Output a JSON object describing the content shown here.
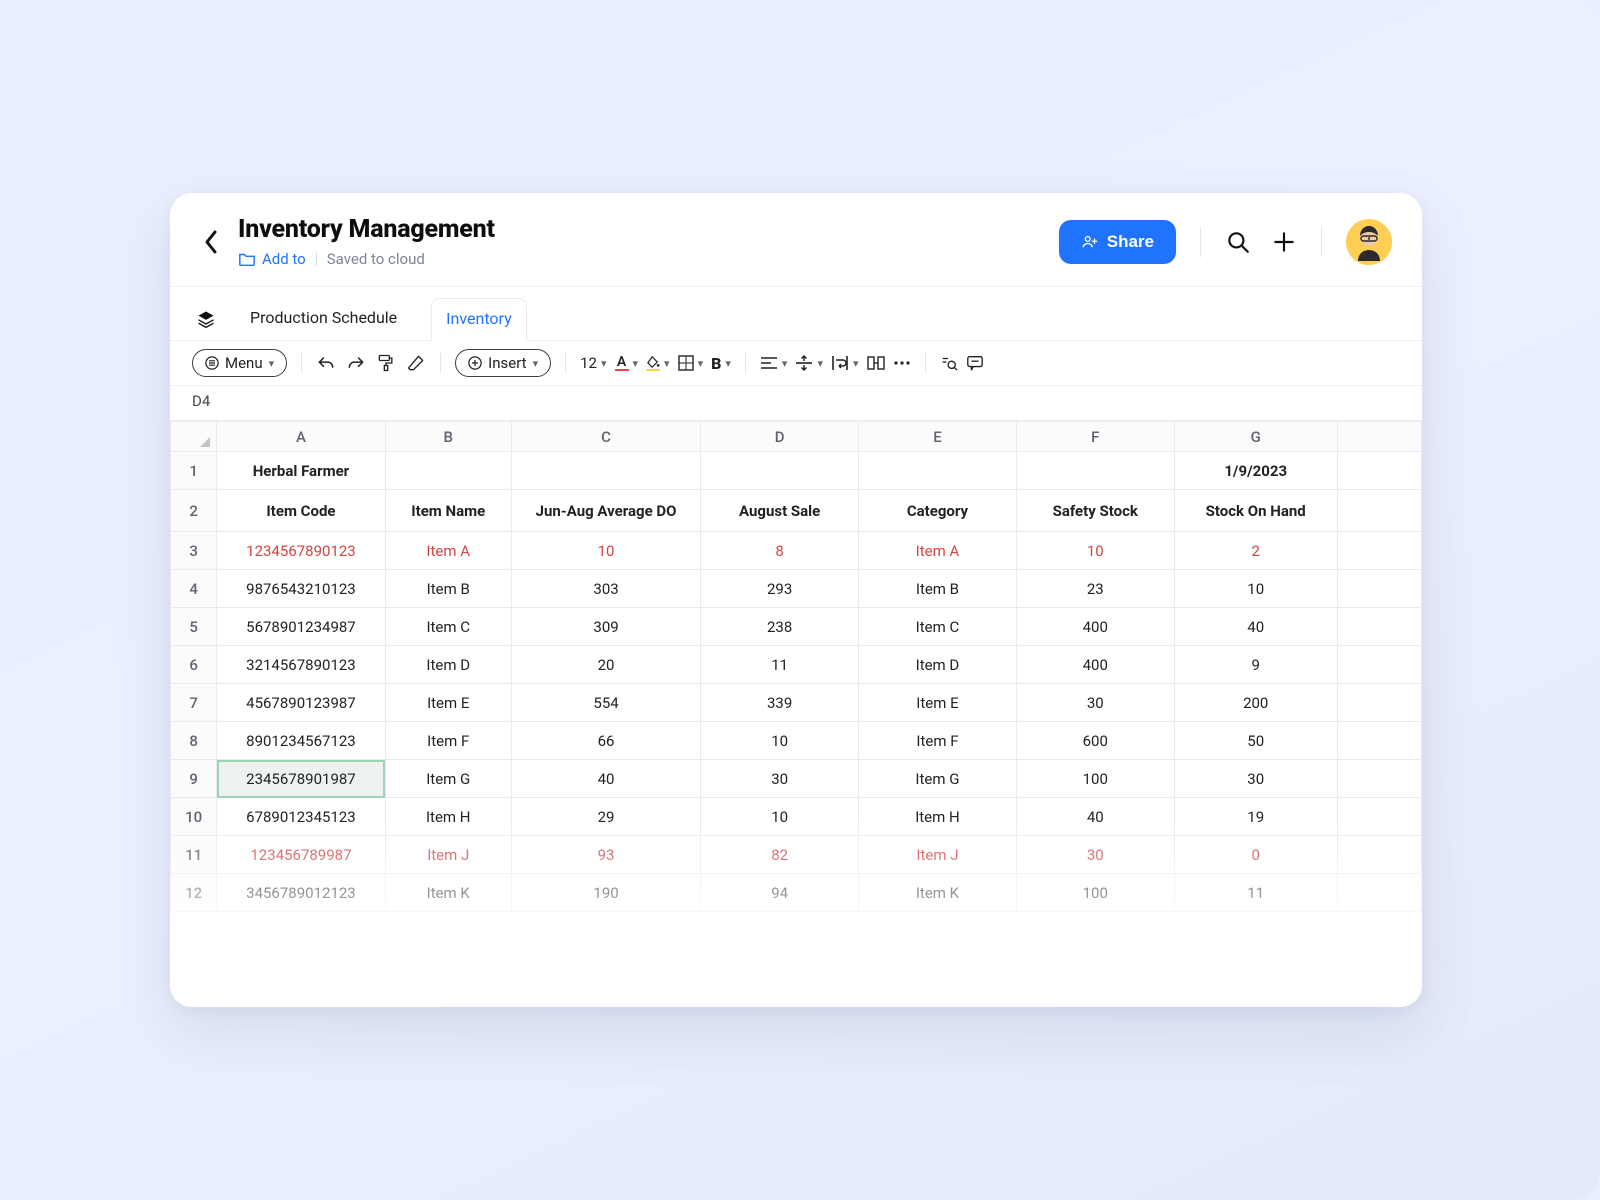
{
  "header": {
    "title": "Inventory Management",
    "add_to": "Add to",
    "saved": "Saved to cloud",
    "share": "Share"
  },
  "tabs": {
    "t0": "Production Schedule",
    "t1": "Inventory"
  },
  "toolbar": {
    "menu": "Menu",
    "insert": "Insert",
    "font_size": "12",
    "text_A": "A",
    "bold": "B"
  },
  "namebox": {
    "ref": "D4"
  },
  "columns": {
    "A": "A",
    "B": "B",
    "C": "C",
    "D": "D",
    "E": "E",
    "F": "F",
    "G": "G"
  },
  "sheet": {
    "row1": {
      "A": "Herbal Farmer",
      "G": "1/9/2023"
    },
    "headers": {
      "A": "Item Code",
      "B": "Item Name",
      "C": "Jun-Aug Average DO",
      "D": "August Sale",
      "E": "Category",
      "F": "Safety Stock",
      "G": "Stock On Hand"
    },
    "rows": [
      {
        "code": "1234567890123",
        "name": "Item A",
        "avg": "10",
        "aug": "8",
        "cat": "Item A",
        "safety": "10",
        "soh": "2",
        "red": true
      },
      {
        "code": "9876543210123",
        "name": "Item B",
        "avg": "303",
        "aug": "293",
        "cat": "Item B",
        "safety": "23",
        "soh": "10"
      },
      {
        "code": "5678901234987",
        "name": "Item C",
        "avg": "309",
        "aug": "238",
        "cat": "Item C",
        "safety": "400",
        "soh": "40"
      },
      {
        "code": "3214567890123",
        "name": "Item D",
        "avg": "20",
        "aug": "11",
        "cat": "Item D",
        "safety": "400",
        "soh": "9"
      },
      {
        "code": "4567890123987",
        "name": "Item E",
        "avg": "554",
        "aug": "339",
        "cat": "Item E",
        "safety": "30",
        "soh": "200"
      },
      {
        "code": "8901234567123",
        "name": "Item F",
        "avg": "66",
        "aug": "10",
        "cat": "Item F",
        "safety": "600",
        "soh": "50"
      },
      {
        "code": "2345678901987",
        "name": "Item G",
        "avg": "40",
        "aug": "30",
        "cat": "Item G",
        "safety": "100",
        "soh": "30",
        "selA": true
      },
      {
        "code": "6789012345123",
        "name": "Item H",
        "avg": "29",
        "aug": "10",
        "cat": "Item H",
        "safety": "40",
        "soh": "19"
      },
      {
        "code": "123456789987",
        "name": "Item J",
        "avg": "93",
        "aug": "82",
        "cat": "Item J",
        "safety": "30",
        "soh": "0",
        "red": true
      },
      {
        "code": "3456789012123",
        "name": "Item K",
        "avg": "190",
        "aug": "94",
        "cat": "Item K",
        "safety": "100",
        "soh": "11"
      }
    ]
  }
}
